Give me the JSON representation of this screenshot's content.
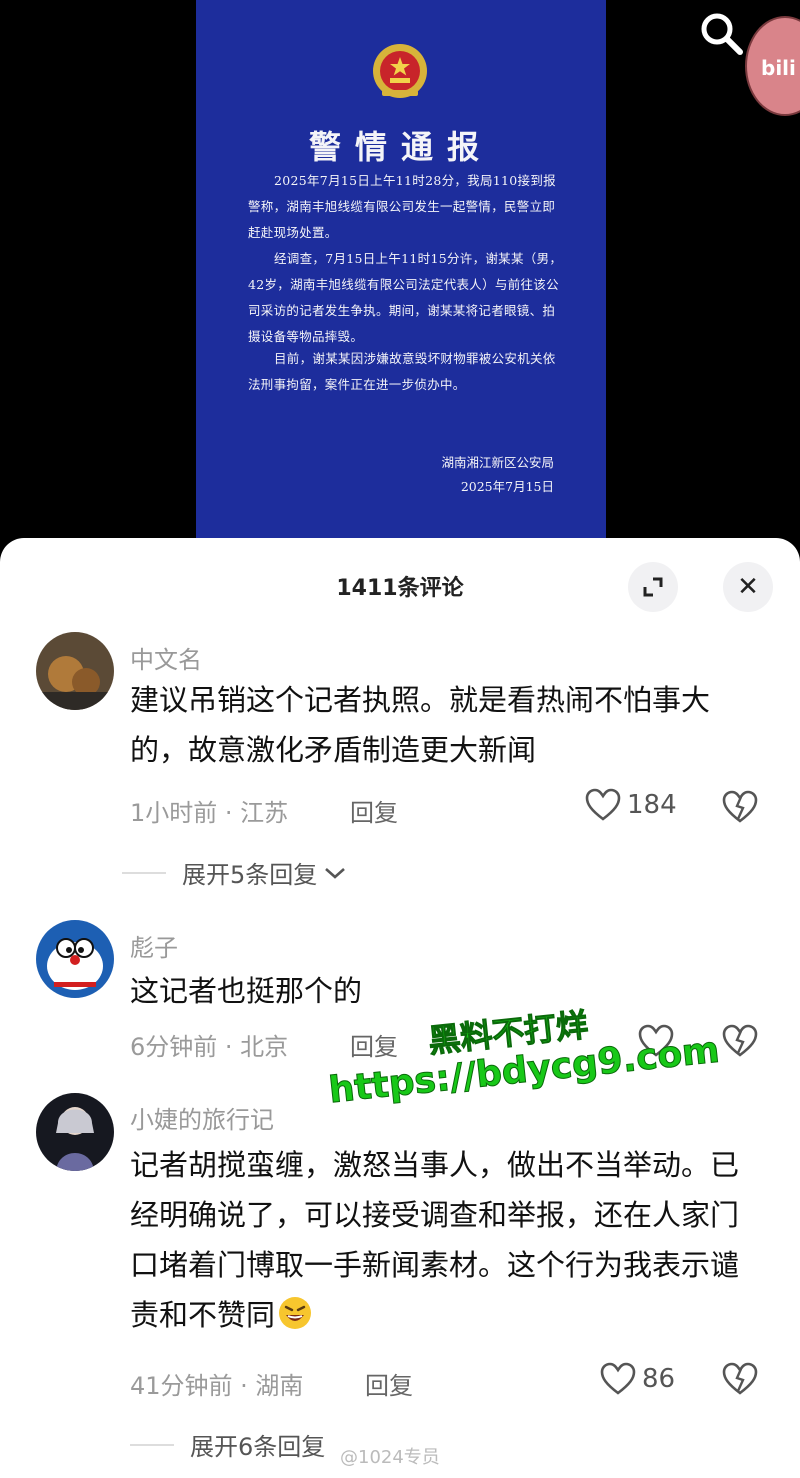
{
  "notice": {
    "title": "警情通报",
    "para1": "2025年7月15日上午11时28分，我局110接到报警称，湖南丰旭线缆有限公司发生一起警情，民警立即赶赴现场处置。",
    "para2": "经调查，7月15日上午11时15分许，谢某某（男，42岁，湖南丰旭线缆有限公司法定代表人）与前往该公司采访的记者发生争执。期间，谢某某将记者眼镜、拍摄设备等物品摔毁。",
    "para3": "目前，谢某某因涉嫌故意毁坏财物罪被公安机关依法刑事拘留，案件正在进一步侦办中。",
    "signature": "湖南湘江新区公安局",
    "date": "2025年7月15日"
  },
  "top_icons": {
    "search": "search-icon",
    "bili_label": "bili"
  },
  "comments_panel": {
    "title": "1411条评论",
    "comments": [
      {
        "name": "中文名",
        "text": "建议吊销这个记者执照。就是看热闹不怕事大的，故意激化矛盾制造更大新闻",
        "time_loc": "1小时前 · 江苏",
        "reply_label": "回复",
        "likes": "184",
        "more_replies": "展开5条回复"
      },
      {
        "name": "彪子",
        "text": "这记者也挺那个的",
        "time_loc": "6分钟前 · 北京",
        "reply_label": "回复"
      },
      {
        "name": "小婕的旅行记",
        "text": "记者胡搅蛮缠，激怒当事人，做出不当举动。已经明确说了，可以接受调查和举报，还在人家门口堵着门博取一手新闻素材。这个行为我表示谴责和不赞同",
        "time_loc": "41分钟前 · 湖南",
        "reply_label": "回复",
        "likes": "86",
        "more_replies": "展开6条回复"
      }
    ]
  },
  "watermark": {
    "line1": "黑料不打烊",
    "line2": "https://bdycg9.com"
  },
  "credit": "@1024专员"
}
